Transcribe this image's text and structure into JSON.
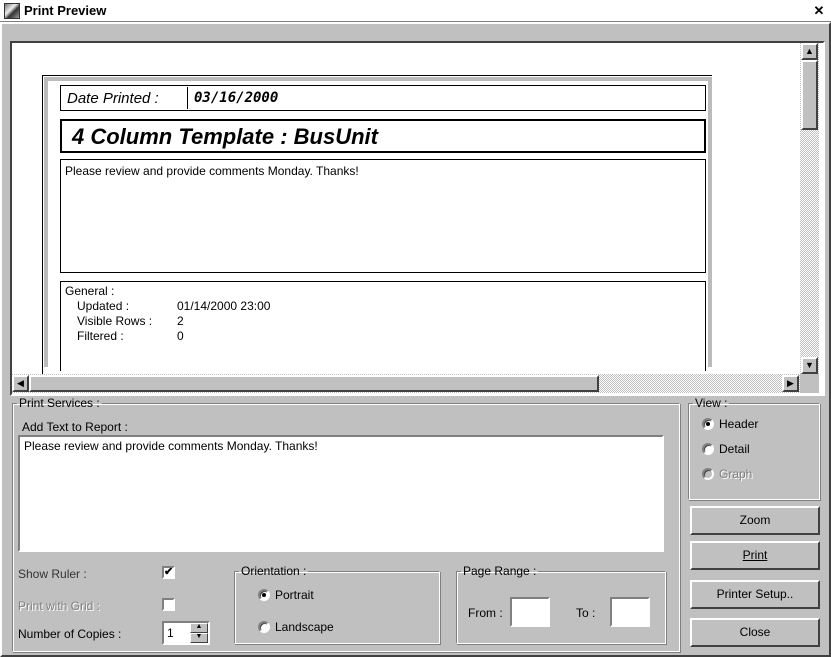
{
  "window": {
    "title": "Print Preview",
    "close_glyph": "✕"
  },
  "preview": {
    "date_label": "Date Printed :",
    "date_value": "03/16/2000",
    "report_title": "4 Column Template : BusUnit",
    "note": "Please review and provide comments Monday.  Thanks!",
    "general_label": "General :",
    "general_rows": [
      {
        "key": "Updated :",
        "value": "01/14/2000 23:00"
      },
      {
        "key": "Visible Rows :",
        "value": "2"
      },
      {
        "key": "Filtered :",
        "value": "0"
      }
    ]
  },
  "print_services": {
    "legend": "Print Services :",
    "add_text_label": "Add Text to Report :",
    "add_text_value": "Please review and provide comments Monday.  Thanks!",
    "show_ruler_label": "Show Ruler  :",
    "show_ruler_checked": true,
    "print_grid_label": "Print with Grid  :",
    "print_grid_checked": false,
    "copies_label": "Number of Copies :",
    "copies_value": "1"
  },
  "orientation": {
    "legend": "Orientation :",
    "options": [
      "Portrait",
      "Landscape"
    ],
    "selected": "Portrait"
  },
  "page_range": {
    "legend": "Page Range :",
    "from_label": "From :",
    "to_label": "To :",
    "from_value": "",
    "to_value": ""
  },
  "view": {
    "legend": "View :",
    "options": [
      "Header",
      "Detail",
      "Graph"
    ],
    "selected": "Header",
    "disabled": [
      "Graph"
    ]
  },
  "buttons": {
    "zoom": "Zoom",
    "print": "Print",
    "printer_setup": "Printer Setup..",
    "close": "Close"
  },
  "icons": {
    "check": "✔",
    "up": "▲",
    "down": "▼",
    "left": "◀",
    "right": "▶"
  }
}
